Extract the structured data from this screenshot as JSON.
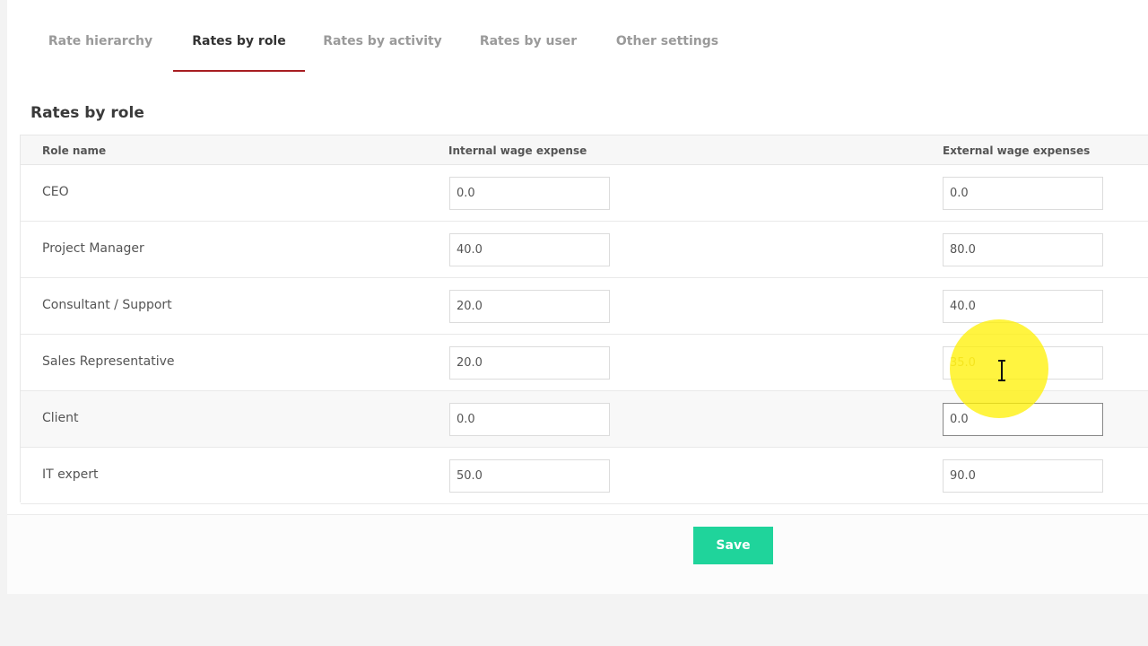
{
  "tabs": [
    {
      "label": "Rate hierarchy"
    },
    {
      "label": "Rates by role"
    },
    {
      "label": "Rates by activity"
    },
    {
      "label": "Rates by user"
    },
    {
      "label": "Other settings"
    }
  ],
  "active_tab": "Rates by role",
  "section_title": "Rates by role",
  "table": {
    "headers": {
      "role_name": "Role name",
      "internal": "Internal wage expense",
      "external": "External wage expenses"
    },
    "rows": [
      {
        "role": "CEO",
        "internal": "0.0",
        "external": "0.0"
      },
      {
        "role": "Project Manager",
        "internal": "40.0",
        "external": "80.0"
      },
      {
        "role": "Consultant / Support",
        "internal": "20.0",
        "external": "40.0"
      },
      {
        "role": "Sales Representative",
        "internal": "20.0",
        "external": "35.0"
      },
      {
        "role": "Client",
        "internal": "0.0",
        "external": "0.0"
      },
      {
        "role": "IT expert",
        "internal": "50.0",
        "external": "90.0"
      }
    ]
  },
  "save_label": "Save",
  "colors": {
    "active_tab_underline": "#a81e22",
    "save_button": "#1fd49b",
    "cursor_highlight": "#fff000"
  },
  "icons": {
    "cursor": "text-cursor-icon"
  }
}
